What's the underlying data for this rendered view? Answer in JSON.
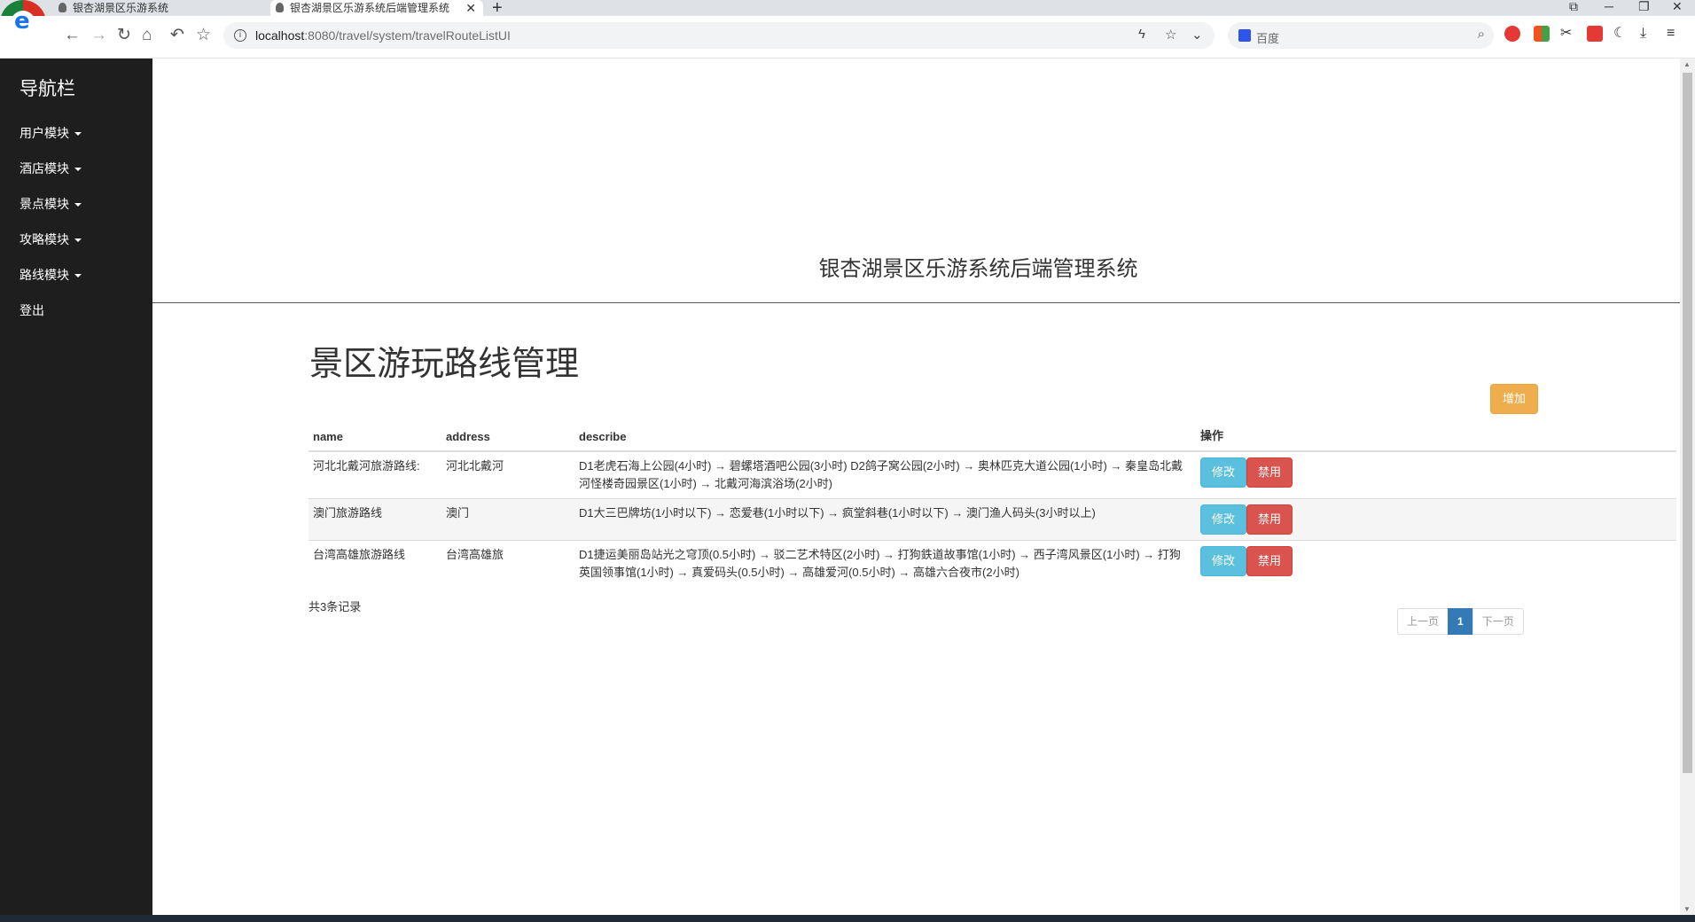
{
  "browser": {
    "tabs": [
      {
        "title": "银杏湖景区乐游系统"
      },
      {
        "title": "银杏湖景区乐游系统后端管理系统"
      }
    ],
    "url_host": "localhost",
    "url_path": ":8080/travel/system/travelRouteListUI",
    "search_placeholder": "百度"
  },
  "sidebar": {
    "brand": "导航栏",
    "items": [
      {
        "label": "用户模块",
        "dropdown": true
      },
      {
        "label": "酒店模块",
        "dropdown": true
      },
      {
        "label": "景点模块",
        "dropdown": true
      },
      {
        "label": "攻略模块",
        "dropdown": true
      },
      {
        "label": "路线模块",
        "dropdown": true
      },
      {
        "label": "登出",
        "dropdown": false
      }
    ]
  },
  "main": {
    "system_title": "银杏湖景区乐游系统后端管理系统",
    "page_title": "景区游玩路线管理",
    "add_label": "增加",
    "table": {
      "headers": [
        "name",
        "address",
        "describe",
        "操作"
      ],
      "rows": [
        {
          "name": "河北北戴河旅游路线:",
          "address": "河北北戴河",
          "describe": "D1老虎石海上公园(4小时) → 碧螺塔酒吧公园(3小时) D2鸽子窝公园(2小时) → 奥林匹克大道公园(1小时) → 秦皇岛北戴河怪楼奇园景区(1小时) → 北戴河海滨浴场(2小时)"
        },
        {
          "name": "澳门旅游路线",
          "address": "澳门",
          "describe": "D1大三巴牌坊(1小时以下) → 恋爱巷(1小时以下) → 疯堂斜巷(1小时以下) → 澳门渔人码头(3小时以上)"
        },
        {
          "name": "台湾高雄旅游路线",
          "address": "台湾高雄旅",
          "describe": "D1捷运美丽岛站光之穹顶(0.5小时) → 驳二艺术特区(2小时) → 打狗鉄道故事馆(1小时) → 西子湾风景区(1小时) → 打狗英国领事馆(1小时) → 真爱码头(0.5小时) → 高雄爱河(0.5小时) → 高雄六合夜市(2小时)"
        }
      ],
      "edit_label": "修改",
      "disable_label": "禁用"
    },
    "record_count": "共3条记录",
    "pagination": {
      "prev": "上一页",
      "current": "1",
      "next": "下一页"
    }
  },
  "colors": {
    "sidebar_bg": "#1e1e1e",
    "add_button": "#f0ad4e",
    "edit_button": "#5bc0de",
    "disable_button": "#d9534f",
    "page_active": "#337ab7"
  }
}
